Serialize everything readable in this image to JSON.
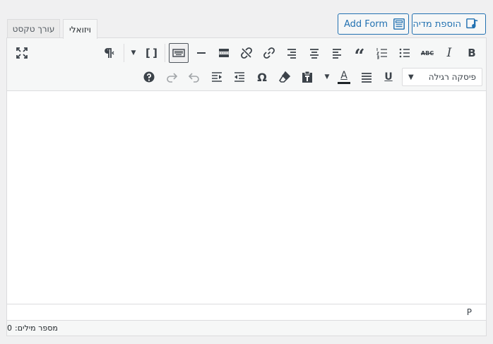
{
  "media_buttons": {
    "add_media_label": "הוספת מדיה",
    "add_form_label": "Add Form"
  },
  "tabs": {
    "visual_label": "ויזואלי",
    "text_label": "עורך טקסט"
  },
  "toolbar": {
    "row1_icons": [
      "bold-icon",
      "italic-icon",
      "strikethrough-icon",
      "bullet-list-icon",
      "numbered-list-icon",
      "blockquote-icon",
      "align-left-icon",
      "align-center-icon",
      "align-right-icon",
      "link-icon",
      "unlink-icon",
      "read-more-icon",
      "horizontal-line-icon",
      "toolbar-toggle-icon",
      "shortcode-icon",
      "rtl-paragraph-icon",
      "fullscreen-icon"
    ],
    "bold_label": "B",
    "italic_label": "I",
    "strike_label": "ABC",
    "row2_icons": [
      "underline-icon",
      "justify-icon",
      "text-color-icon",
      "paste-text-icon",
      "clear-formatting-icon",
      "special-character-icon",
      "outdent-icon",
      "indent-icon",
      "undo-icon",
      "redo-icon",
      "help-icon"
    ],
    "underline_label": "U",
    "text_color_label": "A",
    "omega_label": "Ω",
    "shortcode_label": "[ ]",
    "format_select": {
      "selected": "פיסקה רגילה",
      "arrow": "▼"
    }
  },
  "editor": {
    "path_label": "P",
    "word_count_label": "מספר מילים:",
    "word_count_value": "0"
  },
  "colors": {
    "accent": "#2271b1",
    "text_color_bar": "#1d2327",
    "border": "#dcdcde",
    "toolbar_bg": "#f6f7f7"
  }
}
